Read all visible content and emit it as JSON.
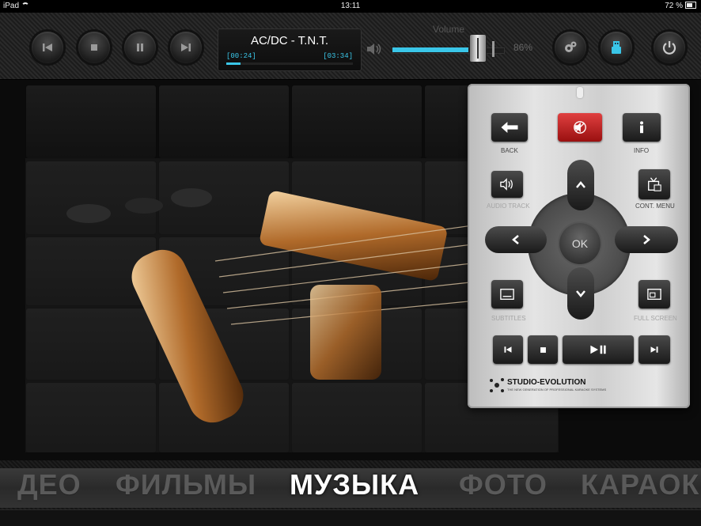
{
  "status_bar": {
    "device": "iPad",
    "time": "13:11",
    "battery": "72 %"
  },
  "player": {
    "track_title": "AC/DC - T.N.T.",
    "elapsed": "[00:24]",
    "total": "[03:34]",
    "progress": 0.11
  },
  "volume": {
    "label": "Volume",
    "percent_label": "86%",
    "level": 0.86
  },
  "toolbar_icons": [
    "previous-icon",
    "stop-icon",
    "pause-icon",
    "next-icon",
    "speaker-icon",
    "gear-icon",
    "usb-icon",
    "power-icon"
  ],
  "remote": {
    "back_label": "BACK",
    "info_label": "INFO",
    "audio_track_label": "AUDIO TRACK",
    "cont_menu_label": "CONT. MENU",
    "ok_label": "OK",
    "subtitles_label": "SUBTITLES",
    "full_screen_label": "FULL SCREEN",
    "brand_name": "STUDIO-EVOLUTION",
    "brand_tagline": "THE NEW GENERATION OF PROFESSIONAL KARAOKE SYSTEMS"
  },
  "categories": [
    {
      "label": "ДЕО",
      "active": false
    },
    {
      "label": "ФИЛЬМЫ",
      "active": false
    },
    {
      "label": "МУЗЫКА",
      "active": true
    },
    {
      "label": "ФОТО",
      "active": false
    },
    {
      "label": "КАРАОК",
      "active": false
    }
  ],
  "colors": {
    "accent": "#3ac6e8",
    "mute_red": "#d22b2b",
    "background": "#0b0b0b"
  }
}
